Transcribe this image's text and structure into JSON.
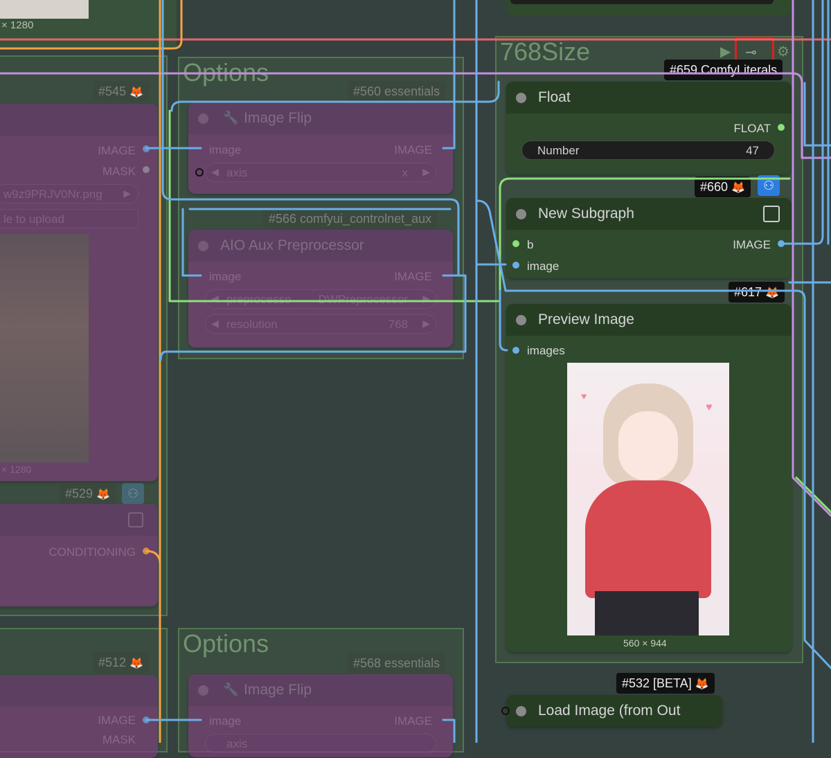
{
  "colors": {
    "canvas": "#35413f",
    "image_link": "#6aaee8",
    "float_link": "#8ee07a",
    "conditioning_link": "#f2a443",
    "literal_link": "#c58ee0",
    "red_link": "#e8626a",
    "highlight": "#e0201c"
  },
  "top_left": {
    "size_label": "× 1280"
  },
  "groups": {
    "options_top": {
      "title": "Options",
      "badge": "#560 essentials"
    },
    "size768": {
      "title": "768Size",
      "badge": "#659 ComfyLiterals"
    },
    "options_bottom": {
      "title": "Options",
      "badge": "#568 essentials"
    }
  },
  "left_node_545": {
    "badge": "#545",
    "out_image": "IMAGE",
    "out_mask": "MASK",
    "filename": "w9z9PRJV0Nr.png",
    "upload_label": "le to upload",
    "size_label": "× 1280"
  },
  "left_node_529": {
    "badge": "#529",
    "out_conditioning": "CONDITIONING"
  },
  "left_node_512": {
    "badge": "#512",
    "out_image": "IMAGE",
    "out_mask": "MASK"
  },
  "image_flip_top": {
    "title": "Image Flip",
    "in_image": "image",
    "out_image": "IMAGE",
    "axis_label": "axis",
    "axis_value": "x"
  },
  "aio_aux": {
    "badge": "#566 comfyui_controlnet_aux",
    "title": "AIO Aux Preprocessor",
    "in_image": "image",
    "out_image": "IMAGE",
    "preprocessor_label": "preprocesso",
    "preprocessor_value": "DWPreprocessor",
    "resolution_label": "resolution",
    "resolution_value": "768"
  },
  "image_flip_bottom": {
    "title": "Image Flip",
    "in_image": "image",
    "out_image": "IMAGE",
    "axis_label": "axis"
  },
  "float_node": {
    "title": "Float",
    "out_label": "FLOAT",
    "number_label": "Number",
    "number_value": "47"
  },
  "subgraph_node": {
    "badge": "#660",
    "title": "New Subgraph",
    "in_b": "b",
    "in_image": "image",
    "out_image": "IMAGE"
  },
  "preview_node": {
    "badge": "#617",
    "title": "Preview Image",
    "in_images": "images",
    "image_size": "560 × 944"
  },
  "load_image_node": {
    "badge": "#532 [BETA]",
    "title": "Load Image (from Out"
  }
}
